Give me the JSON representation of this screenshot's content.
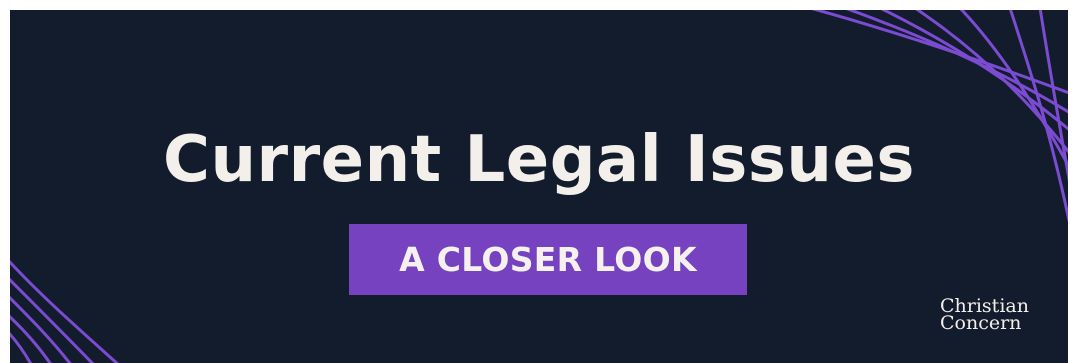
{
  "banner": {
    "title": "Current Legal Issues",
    "subtitle": "A CLOSER LOOK",
    "logo": {
      "line1": "Christian",
      "line2": "Concern"
    }
  },
  "colors": {
    "background": "#121c2c",
    "accent": "#7642bf",
    "line_accent": "#7b4bd1",
    "text": "#f3efea"
  }
}
